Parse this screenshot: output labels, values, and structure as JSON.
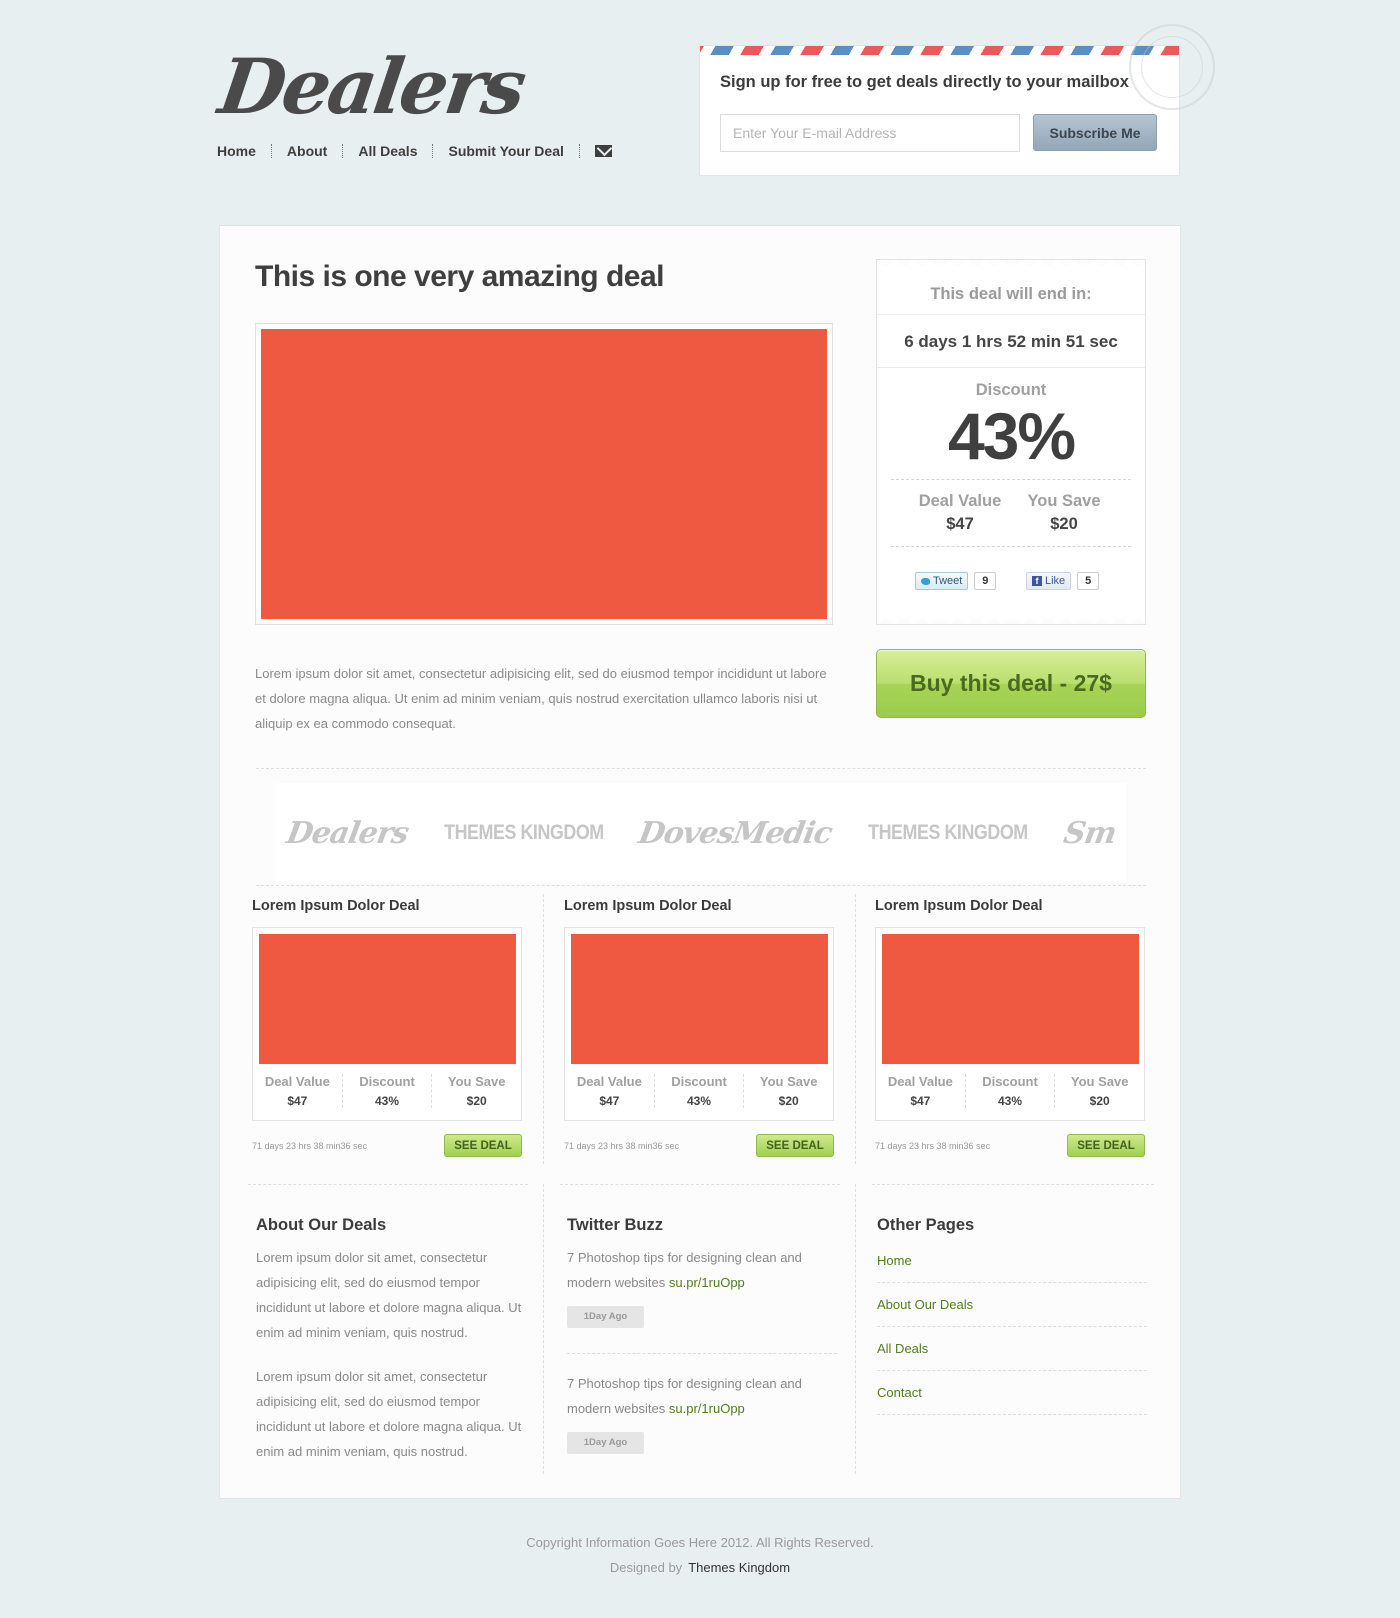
{
  "header": {
    "logo": "Dealers",
    "nav": [
      {
        "label": "Home"
      },
      {
        "label": "About"
      },
      {
        "label": "All Deals"
      },
      {
        "label": "Submit Your Deal"
      }
    ],
    "mail_icon": "envelope-icon"
  },
  "signup": {
    "heading": "Sign up for free to get deals directly to your mailbox",
    "email_placeholder": "Enter Your E-mail Address",
    "email_value": "",
    "button": "Subscribe Me"
  },
  "featured": {
    "title": "This is one very amazing deal",
    "description": "Lorem ipsum dolor sit amet, consectetur adipisicing elit, sed do eiusmod tempor incididunt ut labore et dolore magna aliqua. Ut enim ad minim veniam, quis nostrud exercitation ullamco laboris nisi ut aliquip ex ea commodo consequat.",
    "image_color": "#ef5841",
    "ticket": {
      "ends_label": "This deal will end in:",
      "countdown": "6 days 1 hrs 52 min 51 sec",
      "discount_label": "Discount",
      "discount_value": "43%",
      "deal_value_label": "Deal Value",
      "deal_value": "$47",
      "you_save_label": "You Save",
      "you_save": "$20",
      "tweet_label": "Tweet",
      "tweet_count": "9",
      "like_label": "Like",
      "like_count": "5"
    },
    "buy_button": "Buy this deal - 27$"
  },
  "brands": [
    {
      "name": "Dealers",
      "style": "script"
    },
    {
      "name": "THEMES KINGDOM",
      "style": "caps"
    },
    {
      "name": "DovesMedic",
      "style": "script"
    },
    {
      "name": "THEMES KINGDOM",
      "style": "caps"
    },
    {
      "name": "Sm",
      "style": "script"
    }
  ],
  "small_deals": [
    {
      "title": "Lorem Ipsum  Dolor Deal",
      "deal_value_label": "Deal Value",
      "deal_value": "$47",
      "discount_label": "Discount",
      "discount": "43%",
      "you_save_label": "You Save",
      "you_save": "$20",
      "timer": "71 days 23 hrs 38  min36 sec",
      "button": "SEE DEAL"
    },
    {
      "title": "Lorem Ipsum  Dolor Deal",
      "deal_value_label": "Deal Value",
      "deal_value": "$47",
      "discount_label": "Discount",
      "discount": "43%",
      "you_save_label": "You Save",
      "you_save": "$20",
      "timer": "71 days 23 hrs 38  min36 sec",
      "button": "SEE DEAL"
    },
    {
      "title": "Lorem Ipsum  Dolor Deal",
      "deal_value_label": "Deal Value",
      "deal_value": "$47",
      "discount_label": "Discount",
      "discount": "43%",
      "you_save_label": "You Save",
      "you_save": "$20",
      "timer": "71 days 23 hrs 38  min36 sec",
      "button": "SEE DEAL"
    }
  ],
  "about": {
    "heading": "About Our Deals",
    "paragraphs": [
      "Lorem ipsum dolor sit amet, consectetur adipisicing elit, sed do eiusmod tempor incididunt ut labore et dolore magna aliqua. Ut enim ad minim veniam, quis nostrud.",
      "Lorem ipsum dolor sit amet, consectetur adipisicing elit, sed do eiusmod tempor incididunt ut labore et dolore magna aliqua. Ut enim ad minim veniam, quis nostrud."
    ]
  },
  "twitter": {
    "heading": "Twitter Buzz",
    "tweets": [
      {
        "text": "7 Photoshop tips for designing clean and modern websites",
        "link": "su.pr/1ruOpp",
        "time": "1Day Ago"
      },
      {
        "text": "7 Photoshop tips for designing clean and modern websites",
        "link": "su.pr/1ruOpp",
        "time": "1Day Ago"
      }
    ]
  },
  "other_pages": {
    "heading": "Other Pages",
    "links": [
      "Home",
      "About Our Deals",
      "All Deals",
      "Contact"
    ]
  },
  "footer": {
    "copyright": "Copyright Information Goes Here 2012. All Rights Reserved.",
    "designed_by": "Designed by",
    "designer": "Themes Kingdom"
  }
}
